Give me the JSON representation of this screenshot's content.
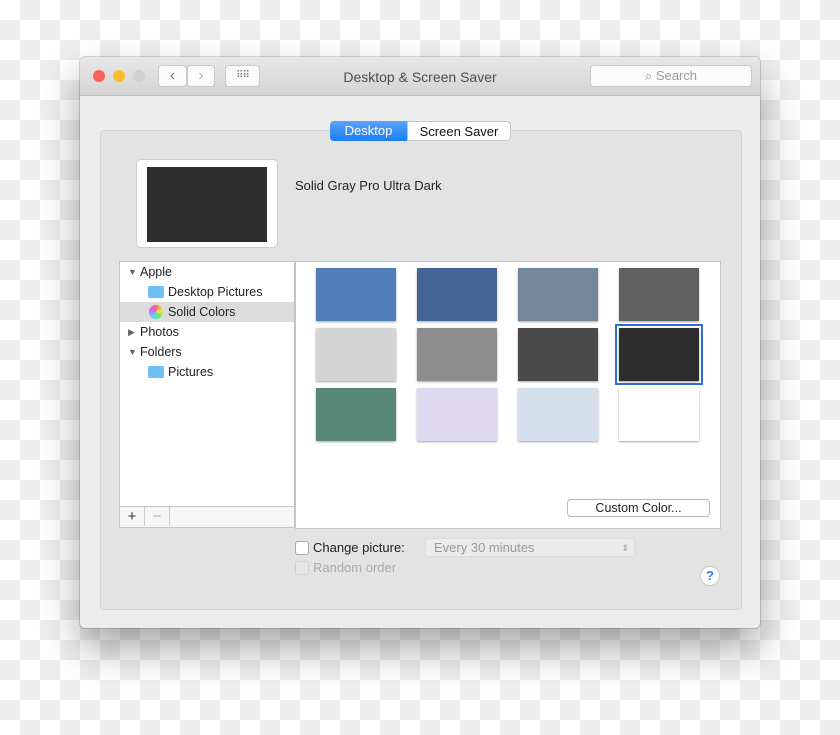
{
  "window": {
    "title": "Desktop & Screen Saver",
    "search_placeholder": "Search"
  },
  "tabs": [
    {
      "label": "Desktop",
      "active": true
    },
    {
      "label": "Screen Saver",
      "active": false
    }
  ],
  "current_picture": "Solid Gray Pro Ultra Dark",
  "sources": [
    {
      "label": "Apple",
      "expanded": true
    },
    {
      "label": "Desktop Pictures"
    },
    {
      "label": "Solid Colors",
      "selected": true
    },
    {
      "label": "Photos",
      "expanded": false
    },
    {
      "label": "Folders",
      "expanded": true
    },
    {
      "label": "Pictures"
    }
  ],
  "add_label": "+",
  "remove_label": "−",
  "swatches": [
    "#507fba",
    "#446697",
    "#76869b",
    "#616161",
    "#d4d4d4",
    "#8e8e8e",
    "#4a4a4a",
    "#2d2d2d",
    "#578878",
    "#dfd9ef",
    "#d3e0ec",
    "#ffffff"
  ],
  "selected_swatch": "#2d2d2d",
  "custom_color_label": "Custom Color...",
  "change_picture": {
    "label": "Change picture:",
    "checked": false,
    "interval": "Every 30 minutes"
  },
  "random_order": {
    "label": "Random order",
    "checked": false,
    "enabled": false
  },
  "help_label": "?"
}
